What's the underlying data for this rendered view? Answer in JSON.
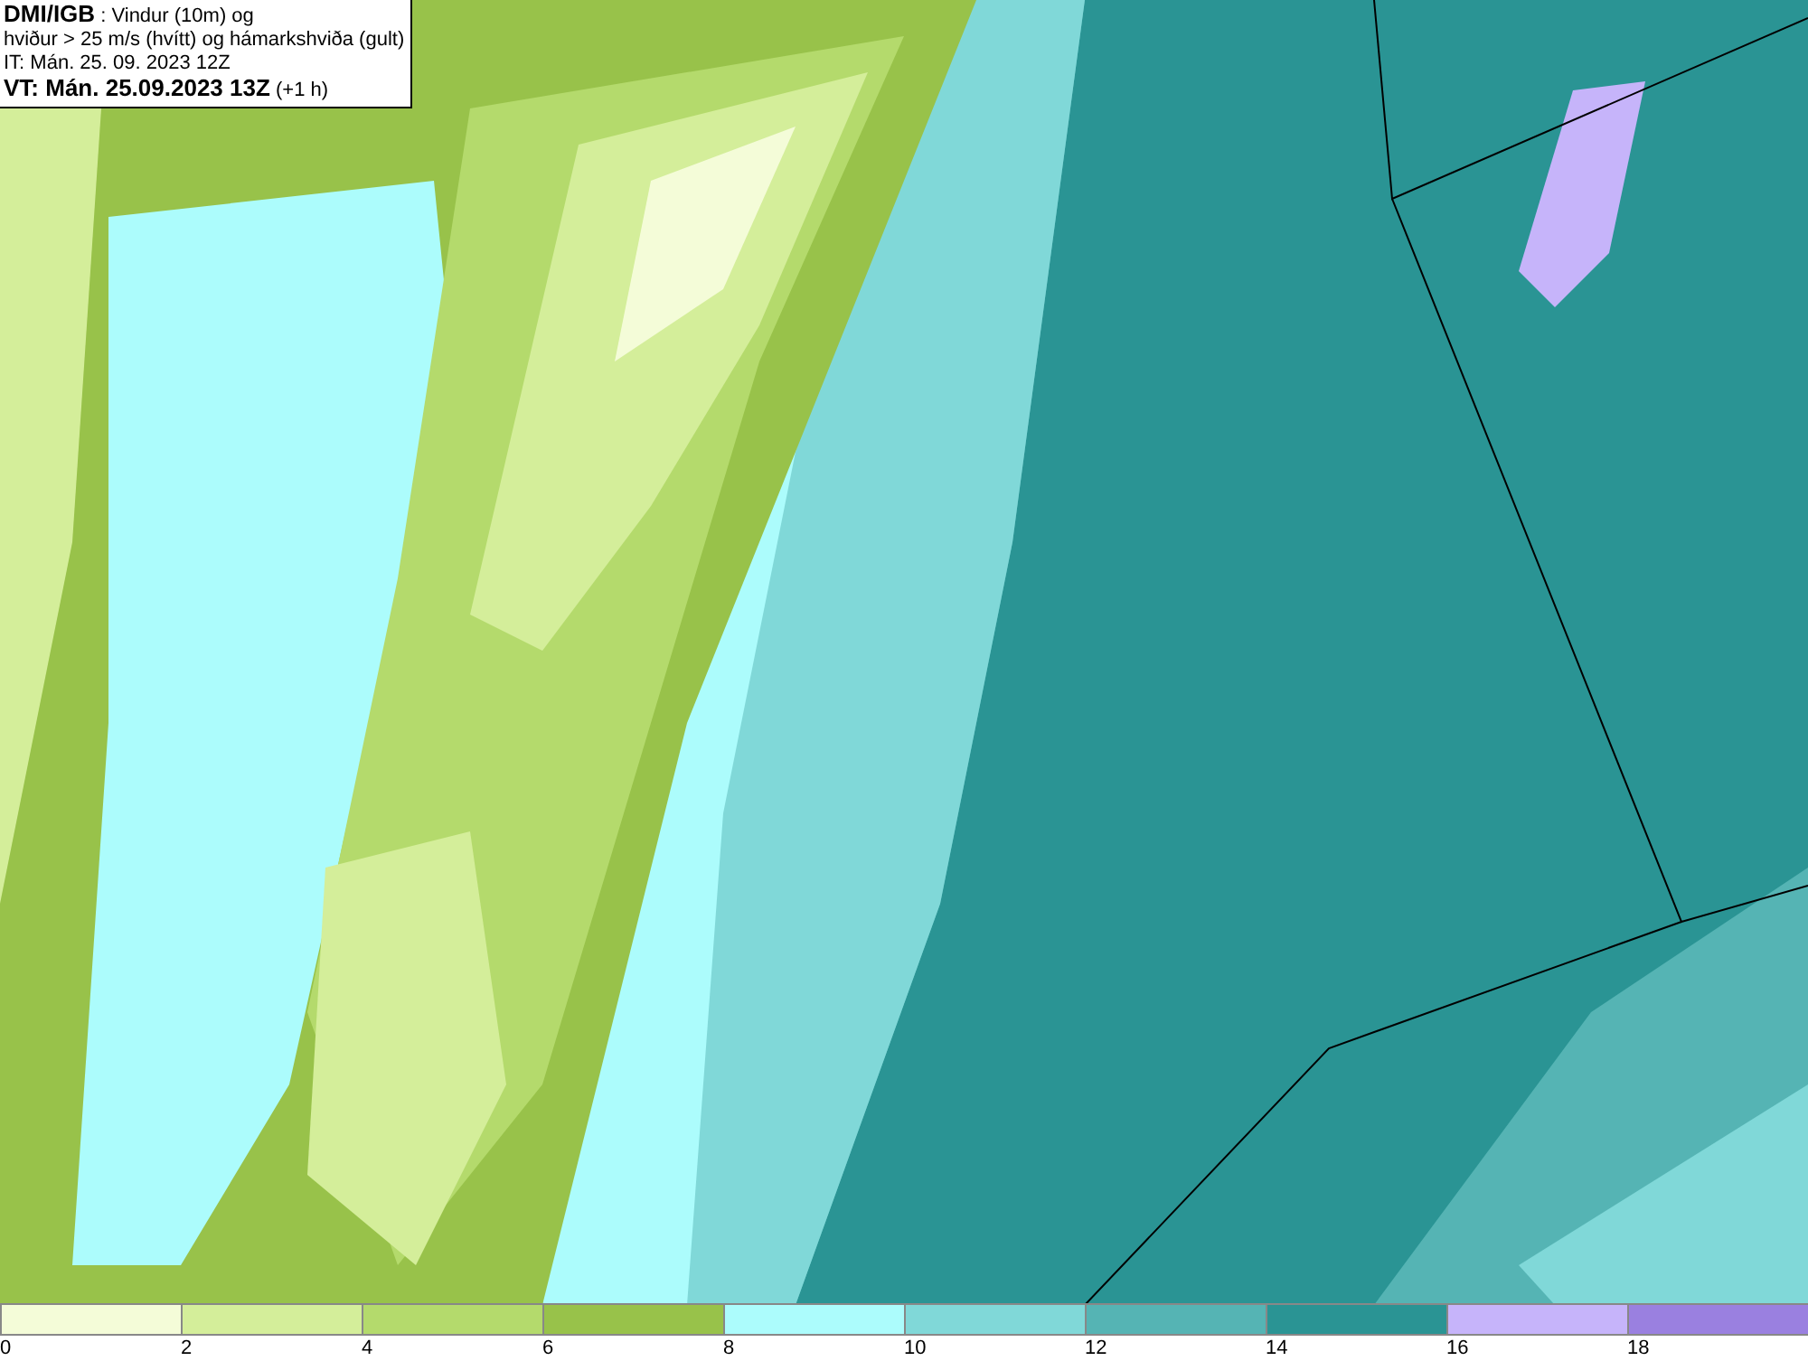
{
  "header": {
    "lines": [
      "**DMI/IGB** : Vindur (10m) og",
      "hviður > 25 m/s (hvítt) og hámarkshviða (gult)",
      "IT: Mán. 25. 09. 2023 12Z",
      "**VT: Mán. 25.09.2023 13Z** (+1 h)"
    ]
  },
  "legend": {
    "items": [
      {
        "label": "0",
        "color": "#f4fcd8"
      },
      {
        "label": "2",
        "color": "#d4ee9a"
      },
      {
        "label": "4",
        "color": "#b4da6c"
      },
      {
        "label": "6",
        "color": "#98c24a"
      },
      {
        "label": "8",
        "color": "#acfcfc"
      },
      {
        "label": "10",
        "color": "#80d8d8"
      },
      {
        "label": "12",
        "color": "#55b4b4"
      },
      {
        "label": "14",
        "color": "#2a9494"
      },
      {
        "label": "16",
        "color": "#c6b4fa"
      },
      {
        "label": "18",
        "color": "#9a80e0"
      }
    ]
  }
}
